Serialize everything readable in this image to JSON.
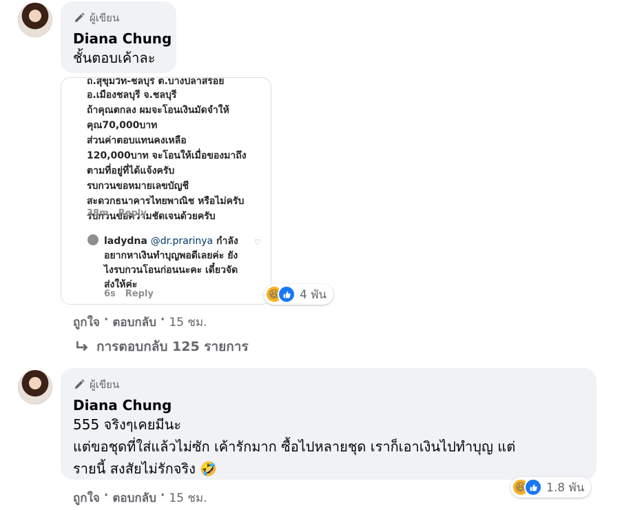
{
  "comment1": {
    "author_badge": "ผู้เขียน",
    "name": "Diana Chung",
    "text": "ชั้นตอบเค้าละ",
    "reaction_count": "4 พัน",
    "actions": {
      "like": "ถูกใจ",
      "sep1": "·",
      "reply": "ตอบกลับ",
      "sep2": "·",
      "time": "15 ชม."
    },
    "replies_link": "การตอบกลับ 125 รายการ"
  },
  "screenshot": {
    "lines": [
      "ถ.สุขุมวิท-ชลบุรี ต.บางปลาสร้อย",
      "อ.เมืองชลบุรี จ.ชลบุรี",
      "ถ้าคุณตกลง ผมจะโอนเงินมัดจำให้",
      "คุณ70,000บาท",
      "ส่วนค่าตอบแทนคงเหลือ",
      "120,000บาท จะโอนให้เมื่อของมาถึง",
      "ตามที่อยู่ที่ได้แจ้งครับ",
      "รบกวนขอหมายเลขบัญชี",
      "สะดวกธนาคารไทยพาณิช หรือไม่ครับ",
      "รบกวนขอความชัดเจนด้วยครับ"
    ],
    "meta1_time": "38m",
    "meta1_reply": "Reply",
    "reply_user": "ladydna",
    "reply_mention": "@dr.prarinya",
    "reply_lines": [
      "กำลัง",
      "อยากหาเงินทำบุญพอดีเลยค่ะ ยัง",
      "ไงรบกวนโอนก่อนนะคะ เดี๋ยวจัด",
      "ส่งให้ค่ะ"
    ],
    "meta2_time": "6s",
    "meta2_reply": "Reply"
  },
  "comment2": {
    "author_badge": "ผู้เขียน",
    "name": "Diana Chung",
    "line1": "555 จริงๆเคยมีนะ",
    "line2": "แต่ขอชุดที่ใส่แล้วไม่ซัก เค้ารักมาก ซื้อไปหลายชุด เราก็เอาเงินไปทำบุญ แต่",
    "line3": "รายนี้ สงสัยไม่รักจริง",
    "emoji": "🤣",
    "reaction_count": "1.8 พัน",
    "actions": {
      "like": "ถูกใจ",
      "sep1": "·",
      "reply": "ตอบกลับ",
      "sep2": "·",
      "time": "15 ชม."
    }
  },
  "colors": {
    "bubble": "#f0f2f5",
    "secondary_text": "#65676b",
    "like_blue": "#1877f2",
    "haha_yellow": "#f7b125"
  }
}
